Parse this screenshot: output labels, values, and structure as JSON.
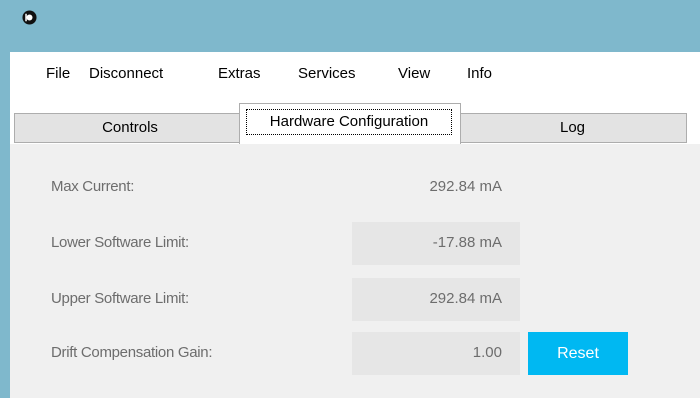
{
  "app": {
    "icon": "app-logo-icon"
  },
  "menu": {
    "items": [
      "File",
      "Disconnect",
      "Extras",
      "Services",
      "View",
      "Info"
    ]
  },
  "tabs": {
    "controls": "Controls",
    "hardware": "Hardware Configuration",
    "log": "Log",
    "active": "Hardware Configuration"
  },
  "config": {
    "max_current": {
      "label": "Max Current:",
      "value": "292.84 mA"
    },
    "lower_limit": {
      "label": "Lower Software Limit:",
      "value": "-17.88 mA"
    },
    "upper_limit": {
      "label": "Upper Software Limit:",
      "value": "292.84 mA"
    },
    "drift_gain": {
      "label": "Drift Compensation Gain:",
      "value": "1.00"
    },
    "reset_label": "Reset"
  },
  "colors": {
    "titlebar": "#7fb8cc",
    "accent": "#00b8f2",
    "panel": "#f0f0f0",
    "field": "#e6e6e6"
  }
}
